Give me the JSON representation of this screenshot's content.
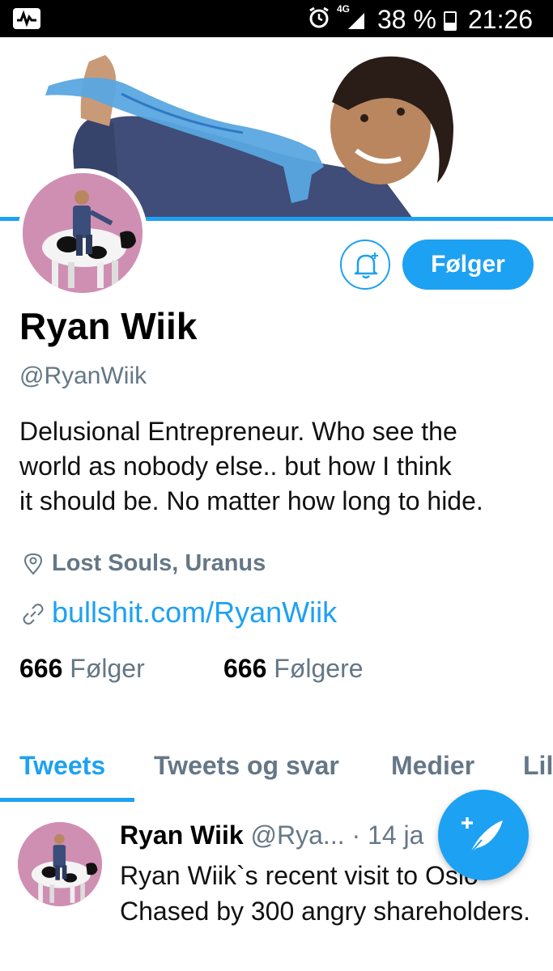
{
  "status_bar": {
    "network": "4G",
    "battery": "38 %",
    "time": "21:26",
    "icons": [
      "activity-icon",
      "alarm-icon",
      "signal-icon",
      "battery-icon"
    ]
  },
  "profile": {
    "name": "Ryan Wiik",
    "handle": "@RyanWiik",
    "bio_lines": [
      "Delusional Entrepreneur. Who see the",
      "world as nobody else.. but how I think",
      "it should be. No matter how long to hide."
    ],
    "location": "Lost Souls, Uranus",
    "website": "bullshit.com/RyanWiik",
    "follow_button_label": "Følger",
    "following_count": "666",
    "following_label": "Følger",
    "followers_count": "666",
    "followers_label": "Følgere"
  },
  "tabs": [
    {
      "label": "Tweets",
      "active": true
    },
    {
      "label": "Tweets og svar",
      "active": false
    },
    {
      "label": "Medier",
      "active": false
    },
    {
      "label": "Lil",
      "active": false
    }
  ],
  "tweet": {
    "name": "Ryan Wiik",
    "handle": "@Rya...",
    "date": "· 14 ja",
    "text_lines": [
      "Ryan Wiik`s recent visit to Oslo",
      "Chased by 300 angry shareholders."
    ]
  },
  "colors": {
    "accent": "#1da1f2",
    "muted": "#657786",
    "avatar_bg": "#cf8fb3"
  }
}
